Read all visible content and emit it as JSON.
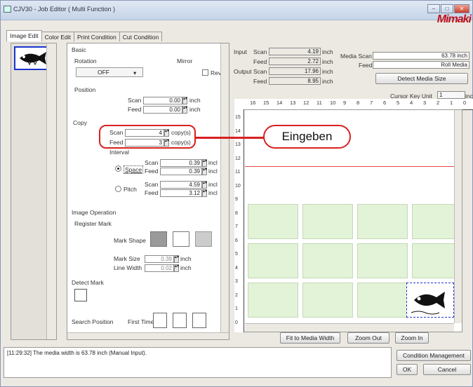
{
  "window": {
    "title": "CJV30 - Job Editor ( Multi Function )",
    "brand": "Mimaki",
    "minimize": "–",
    "maximize": "□",
    "close": "✕"
  },
  "tabs": [
    "Image Edit",
    "Color Edit",
    "Print Condition",
    "Cut Condition"
  ],
  "basic": {
    "header": "Basic",
    "rotation_label": "Rotation",
    "rotation_value": "OFF",
    "mirror_label": "Mirror",
    "rev_label": "Rev",
    "position_label": "Position",
    "pos_scan_label": "Scan",
    "pos_scan_value": "0.00",
    "pos_feed_label": "Feed",
    "pos_feed_value": "0.00",
    "unit_inch": "inch"
  },
  "copy": {
    "header": "Copy",
    "scan_label": "Scan",
    "scan_value": "4",
    "feed_label": "Feed",
    "feed_value": "3",
    "unit_copy": "copy(s)",
    "interval_label": "Interval",
    "space_label": "Space",
    "space_scan_label": "Scan",
    "space_scan_value": "0.39",
    "space_feed_label": "Feed",
    "space_feed_value": "0.39",
    "pitch_label": "Pitch",
    "pitch_scan_label": "Scan",
    "pitch_scan_value": "4.59",
    "pitch_feed_label": "Feed",
    "pitch_feed_value": "3.12",
    "unit_incl": "incl"
  },
  "image_op": {
    "header": "Image Operation",
    "register_mark": "Register Mark",
    "mark_shape": "Mark Shape",
    "mark_size_label": "Mark Size",
    "mark_size_value": "0.39",
    "line_width_label": "Line Width",
    "line_width_value": "0.02",
    "detect_mark": "Detect Mark",
    "search_position": "Search Position",
    "first_time": "First Time",
    "unit_inch": "inch"
  },
  "info": {
    "input_label": "Input",
    "input_scan_label": "Scan",
    "input_scan_value": "4.19",
    "input_feed_label": "Feed",
    "input_feed_value": "2.72",
    "output_label": "Output",
    "output_scan_label": "Scan",
    "output_scan_value": "17.96",
    "output_feed_label": "Feed",
    "output_feed_value": "8.95",
    "unit": "inch"
  },
  "media": {
    "scan_label": "Media Scan",
    "scan_value": "63.78 inch",
    "feed_label": "Feed",
    "feed_value": "Roll Media",
    "detect_button": "Detect Media Size"
  },
  "cursor": {
    "label": "Cursor Key Unit",
    "value": "1",
    "unit": "inch"
  },
  "ruler": {
    "h_ticks": [
      "16",
      "15",
      "14",
      "13",
      "12",
      "11",
      "10",
      "9",
      "8",
      "7",
      "6",
      "5",
      "4",
      "3",
      "2",
      "1",
      "0"
    ],
    "v_ticks": [
      "15",
      "14",
      "13",
      "12",
      "11",
      "10",
      "9",
      "8",
      "7",
      "6",
      "5",
      "4",
      "3",
      "2",
      "1",
      "0"
    ]
  },
  "zoom": {
    "fit_label": "Fit to Media Width",
    "out_label": "Zoom Out",
    "in_label": "Zoom In"
  },
  "status": {
    "message": "[11:29:32] The media width is 63.78 inch (Manual Input)."
  },
  "footer": {
    "condition_button": "Condition Management",
    "ok_button": "OK",
    "cancel_button": "Cancel"
  },
  "annotation": {
    "text": "Eingeben"
  }
}
